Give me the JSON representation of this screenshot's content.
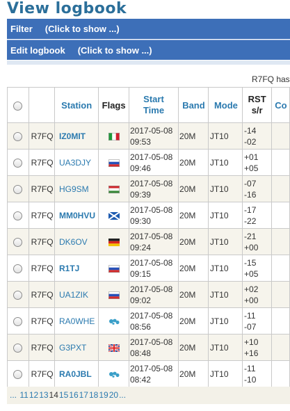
{
  "page_title": "View logbook",
  "filter_bar": {
    "label": "Filter",
    "hint": "(Click to show ...)"
  },
  "edit_bar": {
    "label": "Edit logbook",
    "hint": "(Click to show ...)"
  },
  "notice": "R7FQ has",
  "table": {
    "headers": {
      "station": "Station",
      "flags": "Flags",
      "start_time": "Start Time",
      "band": "Band",
      "mode": "Mode",
      "rst": "RST s/r",
      "comment": "Co"
    },
    "rows": [
      {
        "operator": "R7FQ",
        "station": "IZ0MIT",
        "bold": true,
        "flag": "italy-flag-icon",
        "date": "2017-05-08",
        "time": "09:53",
        "band": "20M",
        "mode": "JT10",
        "rst_s": "-14",
        "rst_r": "-02"
      },
      {
        "operator": "R7FQ",
        "station": "UA3DJY",
        "bold": false,
        "flag": "russia-flag-icon",
        "date": "2017-05-08",
        "time": "09:46",
        "band": "20M",
        "mode": "JT10",
        "rst_s": "+01",
        "rst_r": "+05"
      },
      {
        "operator": "R7FQ",
        "station": "HG9SM",
        "bold": false,
        "flag": "hungary-flag-icon",
        "date": "2017-05-08",
        "time": "09:39",
        "band": "20M",
        "mode": "JT10",
        "rst_s": "-07",
        "rst_r": "-16"
      },
      {
        "operator": "R7FQ",
        "station": "MM0HVU",
        "bold": true,
        "flag": "scotland-flag-icon",
        "date": "2017-05-08",
        "time": "09:30",
        "band": "20M",
        "mode": "JT10",
        "rst_s": "-17",
        "rst_r": "-22"
      },
      {
        "operator": "R7FQ",
        "station": "DK6OV",
        "bold": false,
        "flag": "germany-flag-icon",
        "date": "2017-05-08",
        "time": "09:24",
        "band": "20M",
        "mode": "JT10",
        "rst_s": "-21",
        "rst_r": "+00"
      },
      {
        "operator": "R7FQ",
        "station": "R1TJ",
        "bold": true,
        "flag": "russia-flag-icon",
        "date": "2017-05-08",
        "time": "09:15",
        "band": "20M",
        "mode": "JT10",
        "rst_s": "-15",
        "rst_r": "+05"
      },
      {
        "operator": "R7FQ",
        "station": "UA1ZIK",
        "bold": false,
        "flag": "russia-flag-icon",
        "date": "2017-05-08",
        "time": "09:02",
        "band": "20M",
        "mode": "JT10",
        "rst_s": "+02",
        "rst_r": "+00"
      },
      {
        "operator": "R7FQ",
        "station": "RA0WHE",
        "bold": false,
        "flag": "globe-icon",
        "date": "2017-05-08",
        "time": "08:56",
        "band": "20M",
        "mode": "JT10",
        "rst_s": "-11",
        "rst_r": "-07"
      },
      {
        "operator": "R7FQ",
        "station": "G3PXT",
        "bold": false,
        "flag": "uk-flag-icon",
        "date": "2017-05-08",
        "time": "08:48",
        "band": "20M",
        "mode": "JT10",
        "rst_s": "+10",
        "rst_r": "+16"
      },
      {
        "operator": "R7FQ",
        "station": "RA0JBL",
        "bold": true,
        "flag": "globe-icon",
        "date": "2017-05-08",
        "time": "08:42",
        "band": "20M",
        "mode": "JT10",
        "rst_s": "-11",
        "rst_r": "-10"
      }
    ]
  },
  "pager": {
    "ellipsis_start": "...",
    "pages": [
      "11",
      "12",
      "13",
      "14",
      "15",
      "16",
      "17",
      "18",
      "19",
      "20"
    ],
    "current": "14",
    "ellipsis_end": "..."
  },
  "colors": {
    "bar": "#3d6fb8",
    "link": "#2b7aaf",
    "title": "#2b6f9a",
    "row_odd": "#f6f4ec"
  }
}
